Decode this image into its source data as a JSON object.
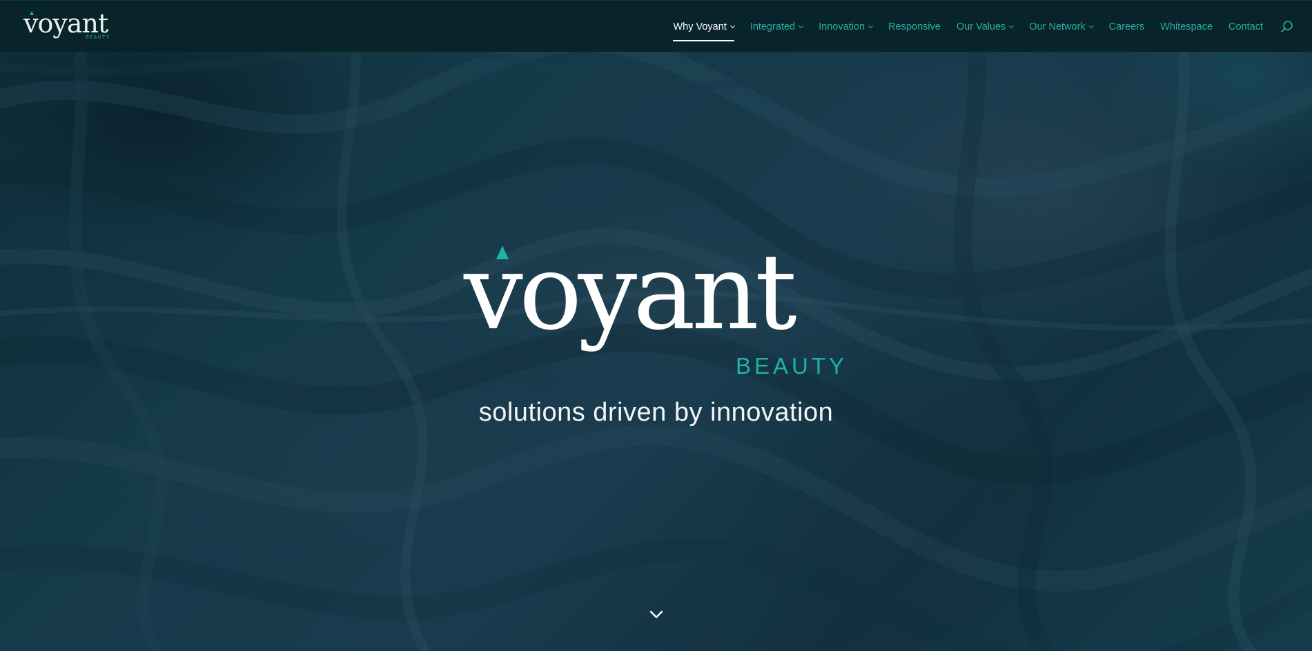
{
  "header": {
    "logo_text": "voyant",
    "logo_sub": "BEAUTY",
    "nav": [
      {
        "label": "Why Voyant",
        "has_dropdown": true,
        "active": true
      },
      {
        "label": "Integrated",
        "has_dropdown": true,
        "active": false
      },
      {
        "label": "Innovation",
        "has_dropdown": true,
        "active": false
      },
      {
        "label": "Responsive",
        "has_dropdown": false,
        "active": false
      },
      {
        "label": "Our Values",
        "has_dropdown": true,
        "active": false
      },
      {
        "label": "Our Network",
        "has_dropdown": true,
        "active": false
      },
      {
        "label": "Careers",
        "has_dropdown": false,
        "active": false
      },
      {
        "label": "Whitespace",
        "has_dropdown": false,
        "active": false
      },
      {
        "label": "Contact",
        "has_dropdown": false,
        "active": false
      }
    ],
    "search_icon": "search-icon"
  },
  "hero": {
    "logo_text": "voyant",
    "logo_sub": "BEAUTY",
    "tagline": "solutions driven by innovation",
    "scroll_icon": "chevron-down-icon"
  },
  "colors": {
    "header_bg": "#082329",
    "accent": "#1fb2a6",
    "text_light": "#ffffff"
  }
}
